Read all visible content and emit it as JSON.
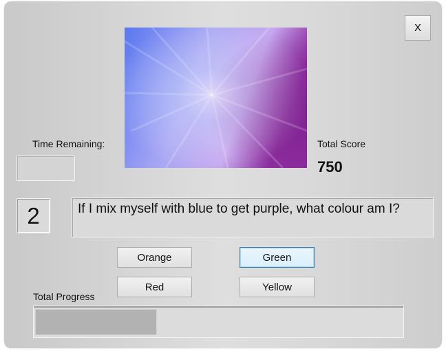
{
  "window": {
    "close_label": "X"
  },
  "timer": {
    "label": "Time Remaining:",
    "value": ""
  },
  "score": {
    "label": "Total Score",
    "value": "750"
  },
  "question": {
    "number": "2",
    "text": "If I mix myself with blue to get purple, what colour am I?"
  },
  "answers": [
    {
      "label": "Orange",
      "focused": false
    },
    {
      "label": "Green",
      "focused": true
    },
    {
      "label": "Red",
      "focused": false
    },
    {
      "label": "Yellow",
      "focused": false
    }
  ],
  "progress": {
    "label": "Total Progress",
    "fraction": 0.33
  },
  "colors": {
    "picture_blue": "#6f8af5",
    "picture_lavender": "#c6a8f0",
    "picture_magenta": "#9a2aa0",
    "focus_border": "#3c7fb1"
  }
}
